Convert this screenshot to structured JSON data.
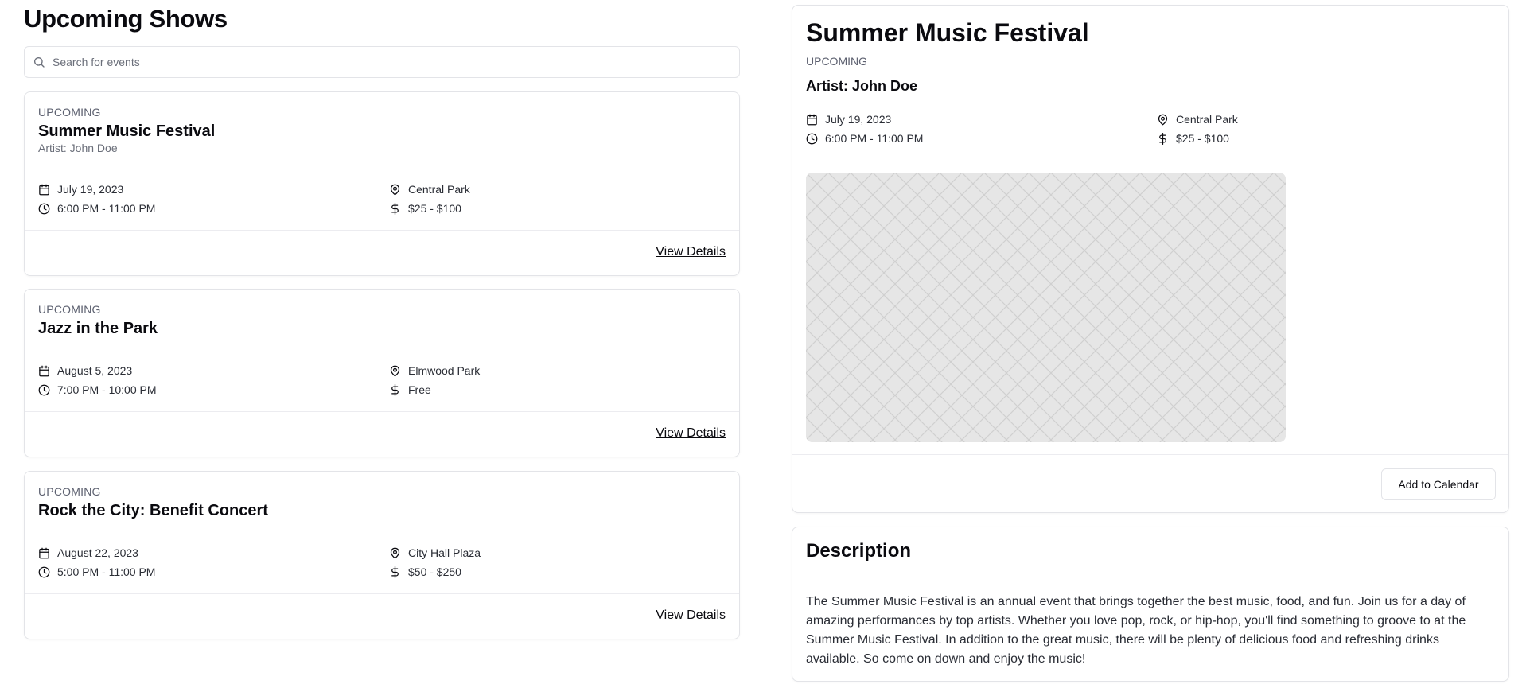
{
  "header": {
    "title": "Upcoming Shows"
  },
  "search": {
    "placeholder": "Search for events",
    "value": ""
  },
  "events": [
    {
      "status": "UPCOMING",
      "title": "Summer Music Festival",
      "artist": "Artist: John Doe",
      "date": "July 19, 2023",
      "time": "6:00 PM - 11:00 PM",
      "location": "Central Park",
      "price": "$25 - $100",
      "link_label": "View Details"
    },
    {
      "status": "UPCOMING",
      "title": "Jazz in the Park",
      "date": "August 5, 2023",
      "time": "7:00 PM - 10:00 PM",
      "location": "Elmwood Park",
      "price": "Free",
      "link_label": "View Details"
    },
    {
      "status": "UPCOMING",
      "title": "Rock the City: Benefit Concert",
      "date": "August 22, 2023",
      "time": "5:00 PM - 11:00 PM",
      "location": "City Hall Plaza",
      "price": "$50 - $250",
      "link_label": "View Details"
    }
  ],
  "detail": {
    "title": "Summer Music Festival",
    "status": "UPCOMING",
    "artist": "Artist: John Doe",
    "date": "July 19, 2023",
    "time": "6:00 PM - 11:00 PM",
    "location": "Central Park",
    "price": "$25 - $100",
    "button_label": "Add to Calendar"
  },
  "description": {
    "heading": "Description",
    "body": "The Summer Music Festival is an annual event that brings together the best music, food, and fun. Join us for a day of amazing performances by top artists. Whether you love pop, rock, or hip-hop, you'll find something to groove to at the Summer Music Festival. In addition to the great music, there will be plenty of delicious food and refreshing drinks available. So come on down and enjoy the music!"
  },
  "icons": {
    "search": "search-icon",
    "date": "calendar-icon",
    "time": "clock-icon",
    "location": "map-pin-icon",
    "price": "dollar-icon",
    "image": "image-placeholder"
  },
  "colors": {
    "text_primary": "#0a0a0f",
    "text_muted": "#5d6170",
    "border": "#e3e4e8",
    "image_bg": "#e6e6e6"
  }
}
